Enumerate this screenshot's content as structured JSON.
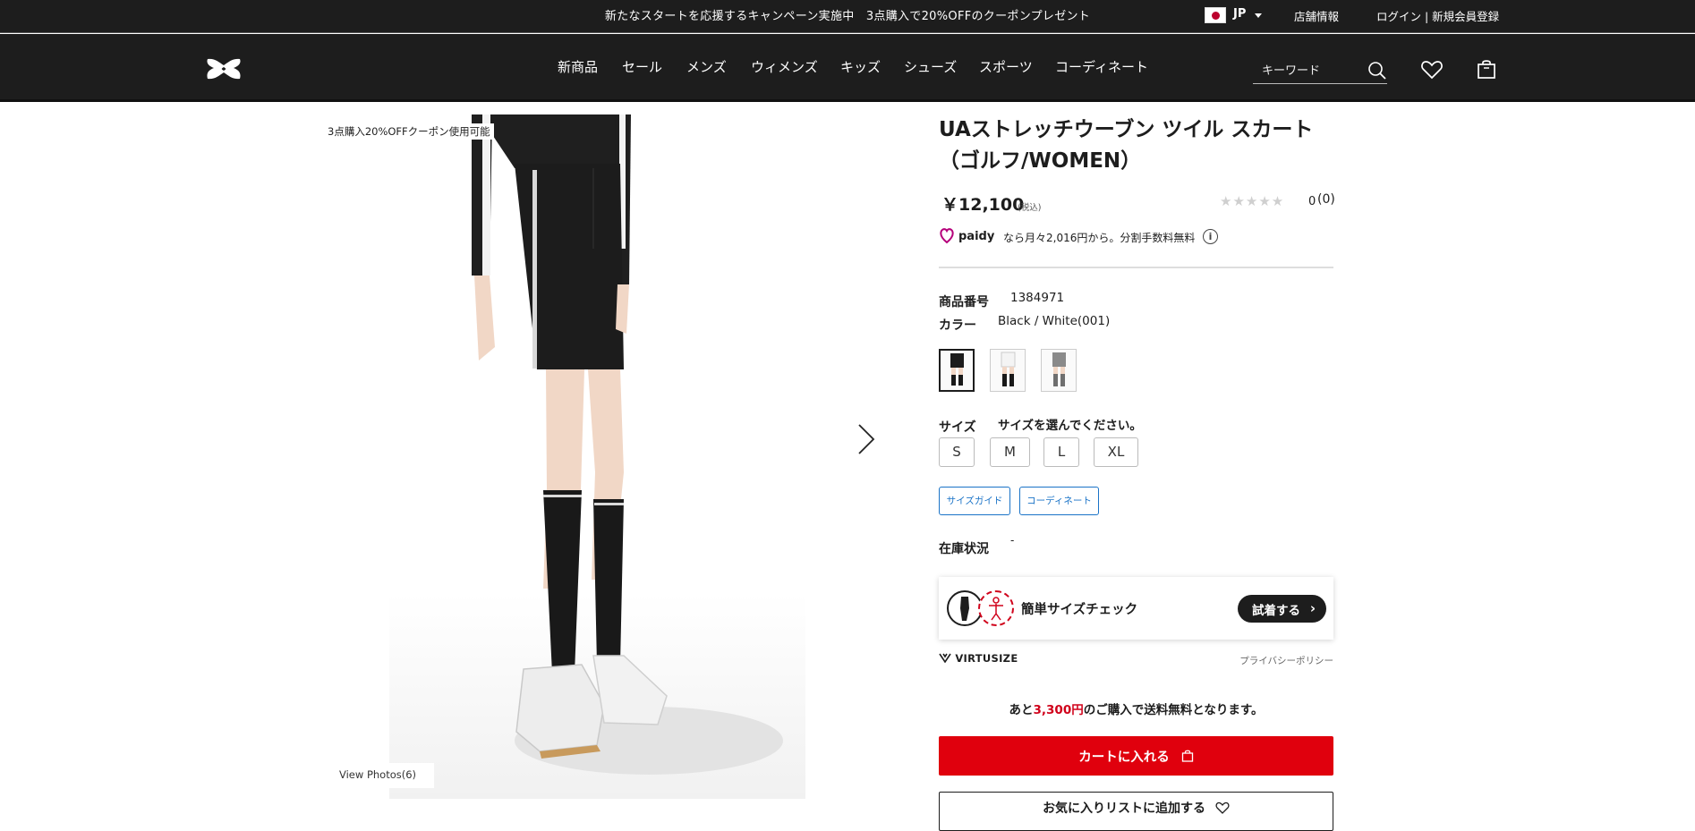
{
  "header": {
    "promo_text": "新たなスタートを応援するキャンペーン実施中　3点購入で20%OFFのクーポンプレゼント",
    "lang": "JP",
    "store_info": "店舗情報",
    "login_register": "ログイン | 新規会員登録",
    "nav": [
      "新商品",
      "セール",
      "メンズ",
      "ウィメンズ",
      "キッズ",
      "シューズ",
      "スポーツ",
      "コーディネート"
    ],
    "search_placeholder": "キーワード"
  },
  "gallery": {
    "coupon_tag": "3点購入20%OFFクーポン使用可能",
    "view_photos": "View Photos(6)"
  },
  "product": {
    "title": "UAストレッチウーブン ツイル スカート（ゴルフ/WOMEN）",
    "price": "￥12,100",
    "tax_label": "(税込)",
    "stars": "★★★★★",
    "rating_value": "0",
    "rating_count": "(0)",
    "paidy_text": "なら月々2,016円から。分割手数料無料",
    "info_icon": "i",
    "item_no_label": "商品番号",
    "item_no": "1384971",
    "color_label": "カラー",
    "color_value": "Black / White(001)",
    "size_label": "サイズ",
    "size_prompt": "サイズを選んでください。",
    "sizes": [
      "S",
      "M",
      "L",
      "XL"
    ],
    "size_guide": "サイズガイド",
    "coordinate": "コーディネート",
    "stock_label": "在庫状況",
    "stock_value": "-"
  },
  "virtusize": {
    "text": "簡単サイズチェック",
    "button": "試着する",
    "chevron": "›",
    "brand": "VIRTUSIZE",
    "privacy": "プライバシーポリシー"
  },
  "shipping": {
    "prefix": "あと",
    "amount": "3,300円",
    "suffix": "のご購入で送料無料となります。"
  },
  "actions": {
    "add_to_cart": "カートに入れる",
    "add_to_wishlist": "お気に入りリストに追加する"
  },
  "colors": {
    "cart_red": "#e0000d",
    "header_bg": "#1d1d1d",
    "link_blue": "#1a73c7"
  }
}
